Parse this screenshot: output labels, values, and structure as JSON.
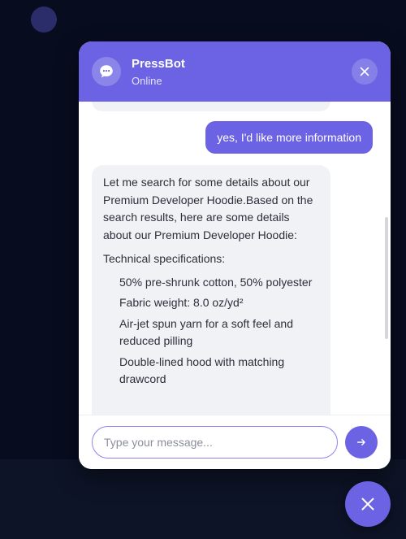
{
  "header": {
    "bot_name": "PressBot",
    "status": "Online",
    "avatar_icon": "chat-bubble-icon",
    "close_icon": "close-icon"
  },
  "messages": [
    {
      "role": "user",
      "text": "yes, I'd like more information"
    },
    {
      "role": "bot",
      "intro": "Let me search for some details about our Premium Developer Hoodie.Based on the search results, here are some details about our Premium Developer Hoodie:",
      "spec_heading": "Technical specifications:",
      "specs": [
        "50% pre-shrunk cotton, 50% polyester",
        "Fabric weight: 8.0 oz/yd²",
        "Air-jet spun yarn for a soft feel and reduced pilling",
        "Double-lined hood with matching drawcord"
      ]
    }
  ],
  "composer": {
    "placeholder": "Type your message...",
    "value": "",
    "send_icon": "arrow-right-icon"
  },
  "launcher": {
    "icon": "close-icon"
  },
  "colors": {
    "accent": "#6b63e3",
    "background": "#080c1f",
    "bubble_bot": "#f1f2f5"
  }
}
